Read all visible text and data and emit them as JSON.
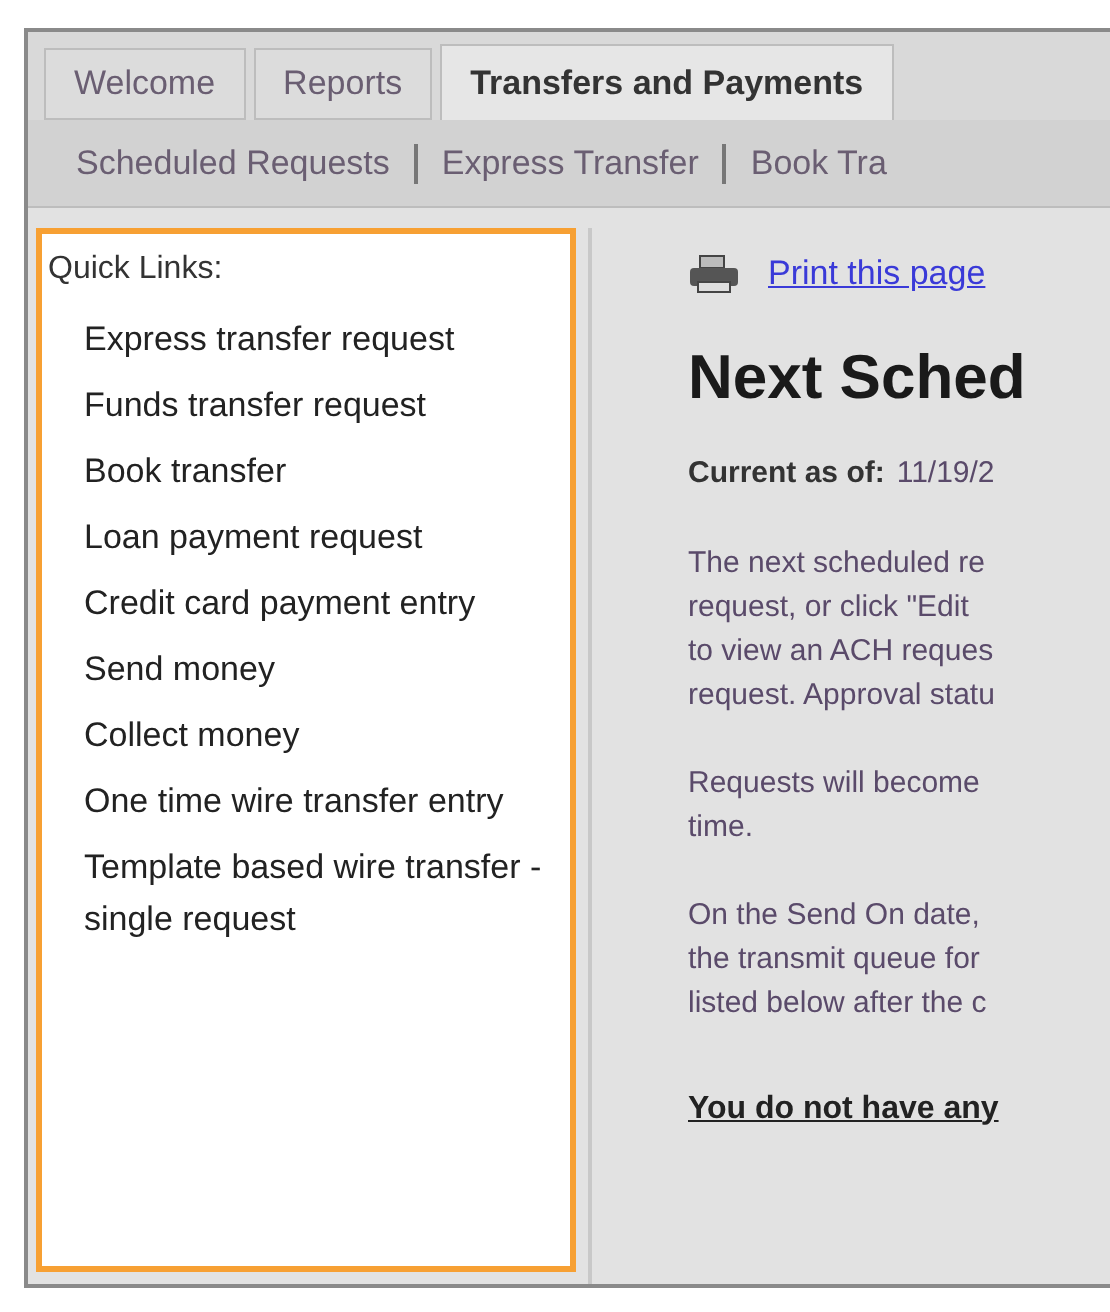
{
  "tabs": [
    {
      "label": "Welcome",
      "selected": false
    },
    {
      "label": "Reports",
      "selected": false
    },
    {
      "label": "Transfers and Payments",
      "selected": true
    }
  ],
  "subnav": [
    "Scheduled Requests",
    "Express Transfer",
    "Book Tra"
  ],
  "quick_links": {
    "title": "Quick Links:",
    "items": [
      "Express transfer request",
      "Funds transfer request",
      "Book transfer",
      "Loan payment request",
      "Credit card payment entry",
      "Send money",
      "Collect money",
      "One time wire transfer entry",
      "Template based wire transfer - single request"
    ]
  },
  "content": {
    "print_link": "Print this page",
    "heading": "Next Sched",
    "current_label": "Current as of:",
    "current_value": "11/19/2",
    "paragraphs": [
      [
        "The next scheduled re",
        "request, or click \"Edit",
        "to view an ACH reques",
        "request. Approval statu"
      ],
      [
        "Requests will become",
        "time."
      ],
      [
        "On the Send On date,",
        "the transmit queue for",
        "listed below after the c"
      ]
    ],
    "notice": "You do not have any"
  }
}
